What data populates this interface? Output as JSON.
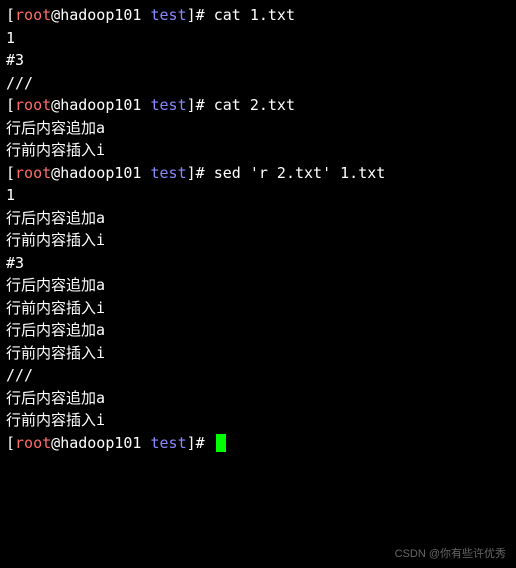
{
  "prompt": {
    "open": "[",
    "user": "root",
    "at": "@",
    "host": "hadoop101",
    "path": " test",
    "close": "]",
    "symbol": "# "
  },
  "commands": {
    "cat1": "cat 1.txt",
    "cat2": "cat 2.txt",
    "sed": "sed 'r 2.txt' 1.txt",
    "empty": ""
  },
  "out": {
    "one": "1",
    "hash3": "#3",
    "blank": "",
    "slashes": "///",
    "appendA": "行后内容追加a",
    "insertI": "行前内容插入i"
  },
  "watermark": "CSDN @你有些许优秀"
}
